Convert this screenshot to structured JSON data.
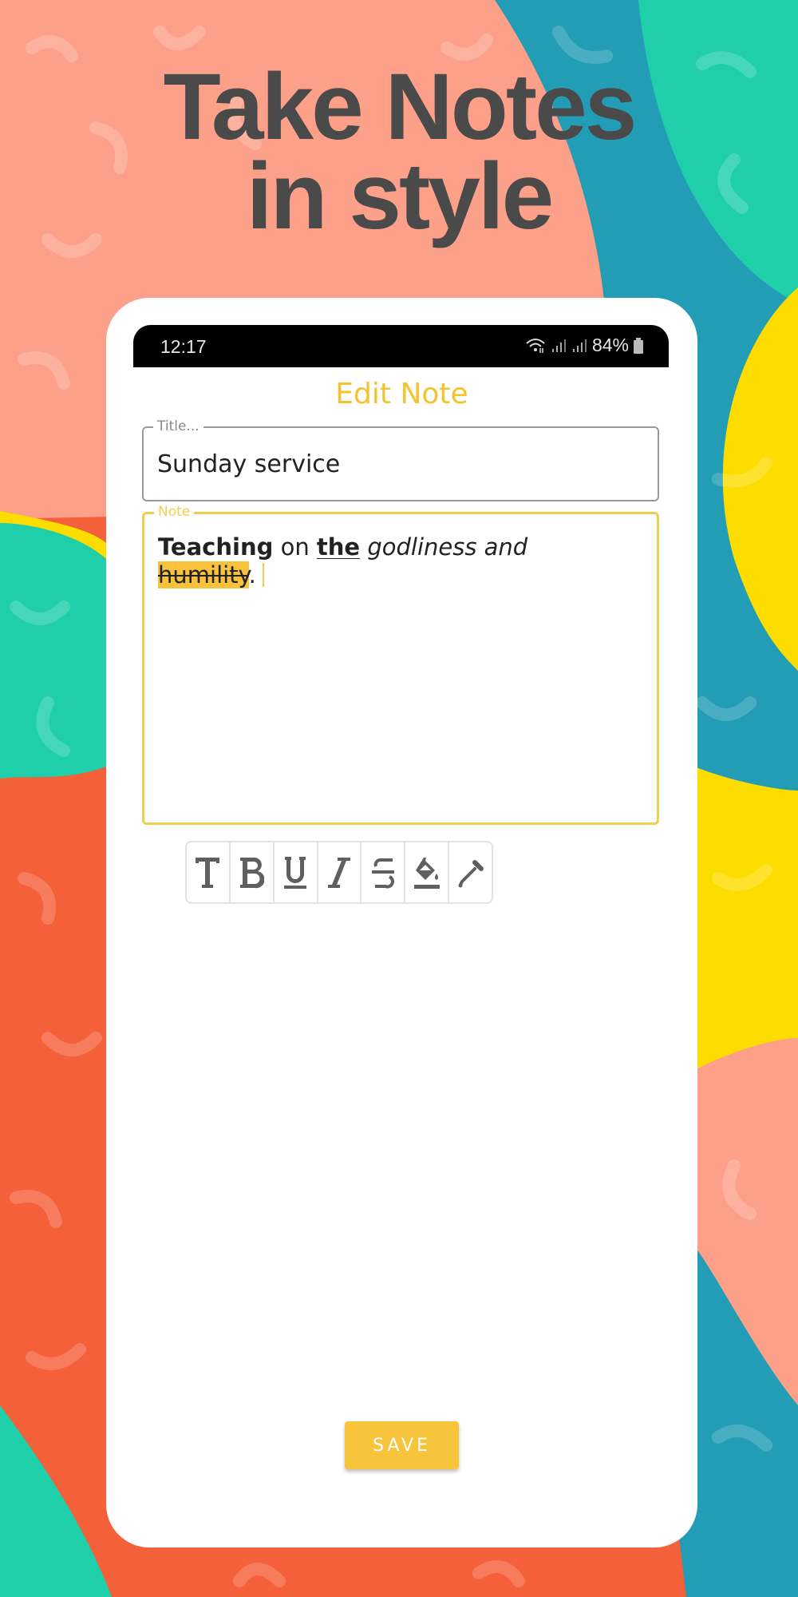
{
  "headline": {
    "line1": "Take Notes",
    "line2": "in style"
  },
  "status_bar": {
    "time": "12:17",
    "battery": "84%",
    "icons": [
      "wifi-icon",
      "signal-icon",
      "signal-icon",
      "battery-icon"
    ]
  },
  "screen": {
    "title": "Edit Note",
    "title_field": {
      "label": "Title...",
      "value": "Sunday service"
    },
    "note_field": {
      "label": "Note",
      "segments": [
        {
          "text": "Teaching",
          "style": "bold"
        },
        {
          "text": " on ",
          "style": "normal"
        },
        {
          "text": "the",
          "style": "bold-underline"
        },
        {
          "text": " godliness and",
          "style": "italic"
        },
        {
          "text": "humility",
          "style": "highlight-strikethrough"
        },
        {
          "text": ".",
          "style": "normal"
        }
      ]
    },
    "toolbar": [
      {
        "name": "text-format",
        "icon": "text-t-icon"
      },
      {
        "name": "bold",
        "icon": "bold-icon"
      },
      {
        "name": "underline",
        "icon": "underline-icon"
      },
      {
        "name": "italic",
        "icon": "italic-icon"
      },
      {
        "name": "strikethrough",
        "icon": "strikethrough-icon"
      },
      {
        "name": "highlight",
        "icon": "fill-bucket-icon"
      },
      {
        "name": "color-picker",
        "icon": "eyedropper-icon"
      }
    ],
    "save_label": "SAVE"
  },
  "colors": {
    "accent": "#f4c430",
    "highlight": "#f9c23c",
    "save": "#f8c43c",
    "icon": "#5f5f5f"
  }
}
